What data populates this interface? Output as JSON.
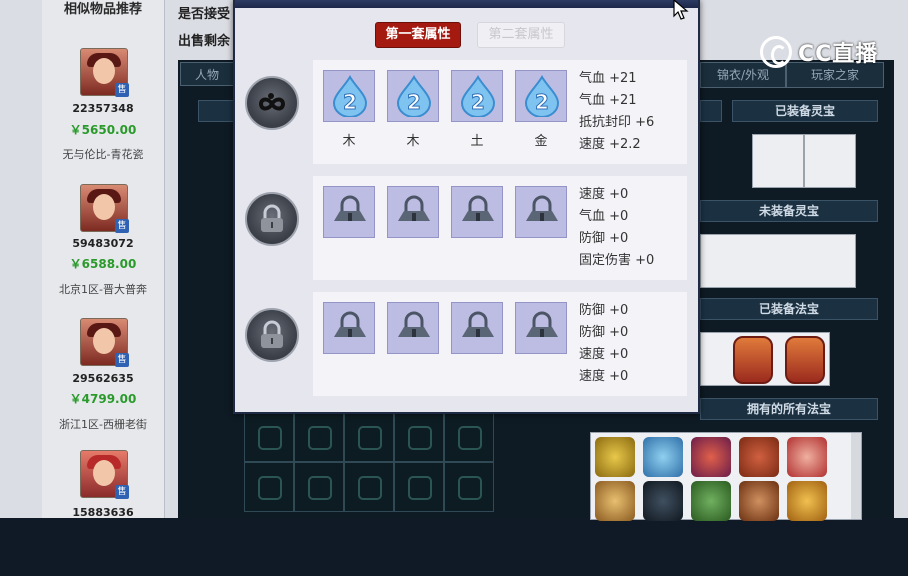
{
  "sidebar": {
    "title": "相似物品推荐",
    "items": [
      {
        "id": "22357348",
        "price": "￥5650.00",
        "server": "无与伦比-青花瓷",
        "badge": "售"
      },
      {
        "id": "59483072",
        "price": "￥6588.00",
        "server": "北京1区-晋大普奔",
        "badge": "售"
      },
      {
        "id": "29562635",
        "price": "￥4799.00",
        "server": "浙江1区-西栅老街",
        "badge": "售"
      },
      {
        "id": "15883636",
        "price": "",
        "server": "",
        "badge": "售"
      }
    ]
  },
  "page": {
    "line1": "是否接受",
    "line2": "出售剩余",
    "tabs": [
      "人物",
      "锦衣/外观",
      "玩家之家"
    ],
    "sections": [
      "已装备灵宝",
      "未装备灵宝",
      "已装备法宝",
      "拥有的所有法宝"
    ]
  },
  "watermark": {
    "text": "CC直播"
  },
  "dialog": {
    "tabs": {
      "first": "第一套属性",
      "second": "第二套属性"
    },
    "rows": [
      {
        "gems": [
          {
            "level": "2",
            "element": "木"
          },
          {
            "level": "2",
            "element": "木"
          },
          {
            "level": "2",
            "element": "土"
          },
          {
            "level": "2",
            "element": "金"
          }
        ],
        "attributes": [
          "气血 +21",
          "气血 +21",
          "抵抗封印 +6",
          "速度 +2.2"
        ]
      },
      {
        "gems": [],
        "attributes": [
          "速度 +0",
          "气血 +0",
          "防御 +0",
          "固定伤害 +0"
        ]
      },
      {
        "gems": [],
        "attributes": [
          "防御 +0",
          "防御 +0",
          "速度 +0",
          "速度 +0"
        ]
      }
    ]
  },
  "colors": {
    "active_tab": "#a51a10",
    "gem_slot": "#bdbde3",
    "price_green": "#2a9a2a"
  }
}
